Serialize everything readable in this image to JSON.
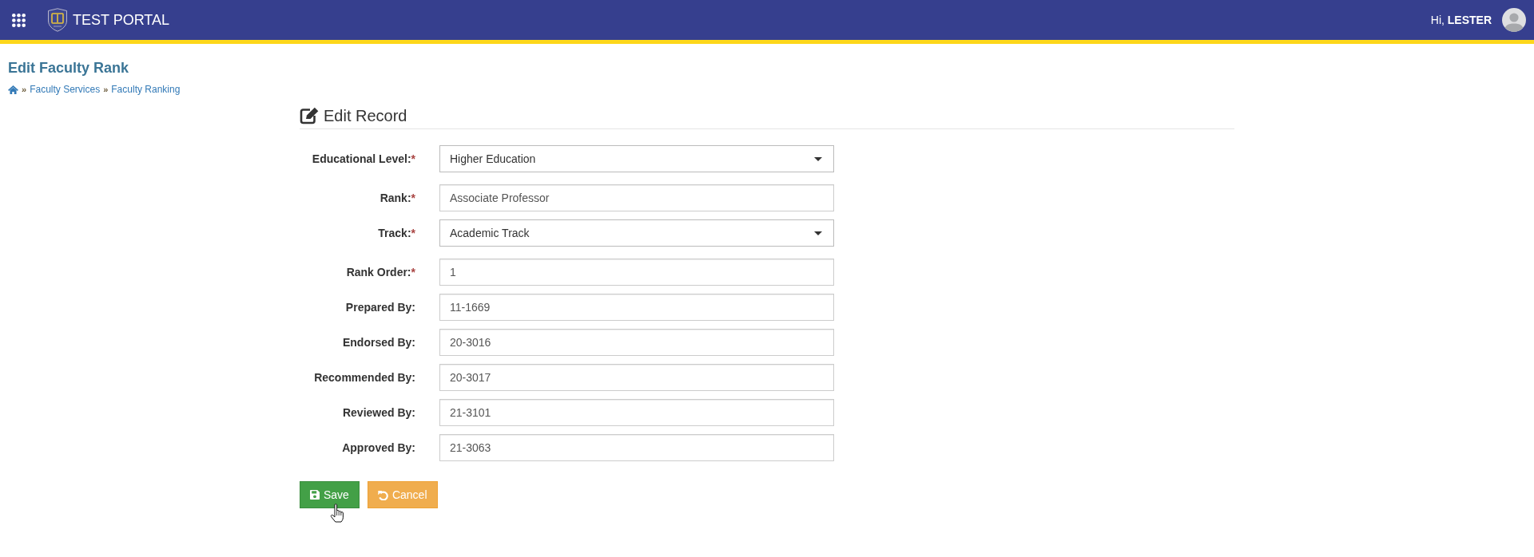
{
  "header": {
    "app_title": "TEST PORTAL",
    "greeting": "Hi, **LESTER**"
  },
  "page": {
    "title": "Edit Faculty Rank",
    "breadcrumb": [
      {
        "separator": "»",
        "label": "Faculty Services"
      },
      {
        "separator": "»",
        "label": "Faculty Ranking"
      }
    ]
  },
  "form": {
    "title": "Edit Record",
    "fields": [
      {
        "kind": "select",
        "label": "Educational Level:",
        "required_mark": "*",
        "value": "Higher Education"
      },
      {
        "kind": "text",
        "label": "Rank:",
        "required_mark": "*",
        "value": "Associate Professor"
      },
      {
        "kind": "select",
        "label": "Track:",
        "required_mark": "*",
        "value": "Academic Track"
      },
      {
        "kind": "text",
        "label": "Rank Order:",
        "required_mark": "*",
        "value": "1"
      },
      {
        "kind": "text",
        "label": "Prepared By:",
        "value": "11-1669"
      },
      {
        "kind": "text",
        "label": "Endorsed By:",
        "value": "20-3016"
      },
      {
        "kind": "text",
        "label": "Recommended By:",
        "value": "20-3017"
      },
      {
        "kind": "text",
        "label": "Reviewed By:",
        "value": "21-3101"
      },
      {
        "kind": "text",
        "label": "Approved By:",
        "value": "21-3063"
      }
    ],
    "buttons": [
      {
        "kind": "save",
        "label": "Save"
      },
      {
        "kind": "cancel",
        "label": "Cancel"
      }
    ]
  }
}
